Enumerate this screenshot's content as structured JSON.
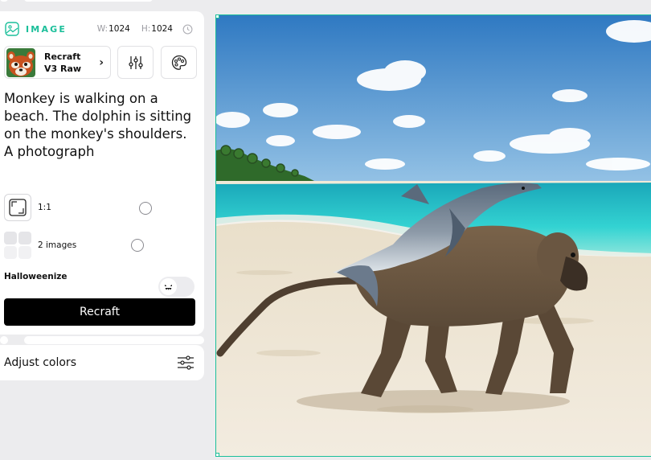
{
  "mode": {
    "label": "IMAGE",
    "icon": "image-mode-icon",
    "accent": "#1bbf9a"
  },
  "dimensions": {
    "w_label": "W:",
    "w_value": "1024",
    "h_label": "H:",
    "h_value": "1024",
    "history_icon": "clock-icon"
  },
  "model": {
    "line1": "Recraft",
    "line2": "V3 Raw",
    "chevron": "›"
  },
  "toolbar": {
    "settings_icon": "sliders-vertical-icon",
    "palette_icon": "palette-icon"
  },
  "prompt": {
    "text": "Monkey is walking on a beach. The dolphin is sitting on the monkey's shoulders. A photograph"
  },
  "options": {
    "ratio": {
      "label": "1:1",
      "selected": false
    },
    "count": {
      "label": "2 images",
      "selected": false
    },
    "halloweenize": {
      "label": "Halloweenize",
      "enabled": false
    }
  },
  "actions": {
    "recraft_label": "Recraft",
    "button_color": "#000000"
  },
  "adjust": {
    "label": "Adjust colors",
    "icon": "sliders-horizontal-icon"
  },
  "canvas": {
    "image": "monkey-dolphin-beach-photo",
    "selection_color": "#1bbf9a"
  }
}
